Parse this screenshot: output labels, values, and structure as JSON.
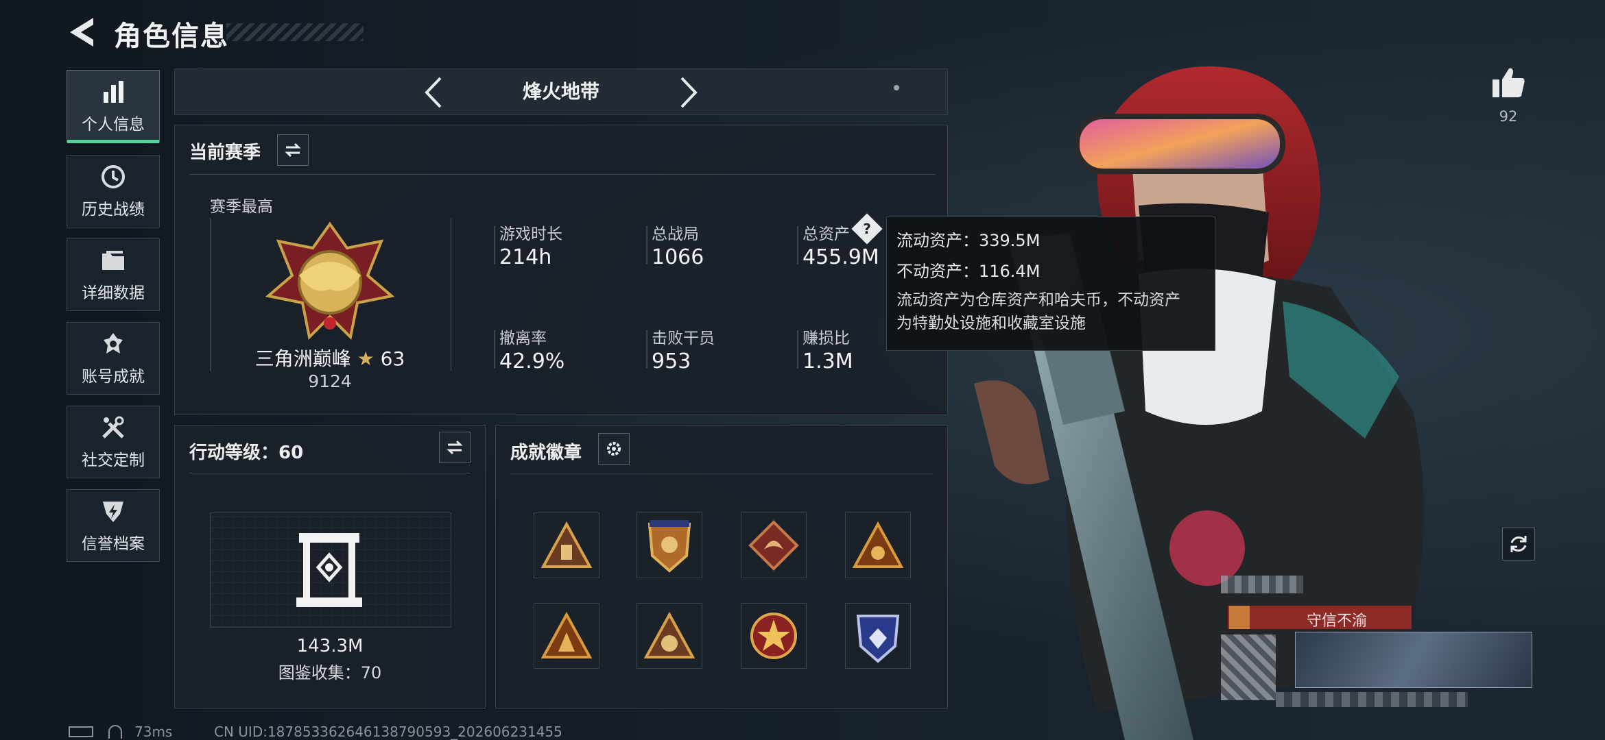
{
  "header": {
    "title": "角色信息"
  },
  "sidebar": {
    "items": [
      {
        "label": "个人信息",
        "icon": "bar-chart-icon",
        "active": true
      },
      {
        "label": "历史战绩",
        "icon": "history-icon"
      },
      {
        "label": "详细数据",
        "icon": "folder-icon"
      },
      {
        "label": "账号成就",
        "icon": "achievement-icon"
      },
      {
        "label": "社交定制",
        "icon": "tools-icon"
      },
      {
        "label": "信誉档案",
        "icon": "shield-bolt-icon"
      }
    ]
  },
  "mode_bar": {
    "title": "烽火地带"
  },
  "season": {
    "title": "当前赛季",
    "best_label": "赛季最高",
    "rank_name": "三角洲巅峰",
    "rank_stars": "63",
    "rank_points": "9124",
    "stats": [
      {
        "label": "游戏时长",
        "value": "214h"
      },
      {
        "label": "总战局",
        "value": "1066"
      },
      {
        "label": "总资产",
        "value": "455.9M"
      },
      {
        "label": "撤离率",
        "value": "42.9%"
      },
      {
        "label": "击败干员",
        "value": "953"
      },
      {
        "label": "赚损比",
        "value": "1.3M"
      }
    ]
  },
  "tooltip": {
    "liquid": "流动资产：339.5M",
    "fixed": "不动资产：116.4M",
    "desc_line1": "流动资产为仓库资产和哈夫币，不动资产",
    "desc_line2": "为特勤处设施和收藏室设施"
  },
  "level": {
    "title": "行动等级：60",
    "collection_value": "143.3M",
    "collection_label": "图鉴收集：70"
  },
  "badges": {
    "title": "成就徽章",
    "items": [
      "badge-1",
      "badge-2",
      "badge-3",
      "badge-4",
      "badge-5",
      "badge-6",
      "badge-7",
      "badge-8"
    ]
  },
  "likes": {
    "count": "92"
  },
  "player_card": {
    "title_tag": "守信不渝"
  },
  "footer": {
    "ping": "73ms",
    "uid": "CN UID:18785336264613879059​3_202606231455"
  },
  "colors": {
    "accent_green": "#56d39a",
    "bg": "#141c25",
    "panel": "#1a2129",
    "tag_red": "#8e2a25"
  }
}
